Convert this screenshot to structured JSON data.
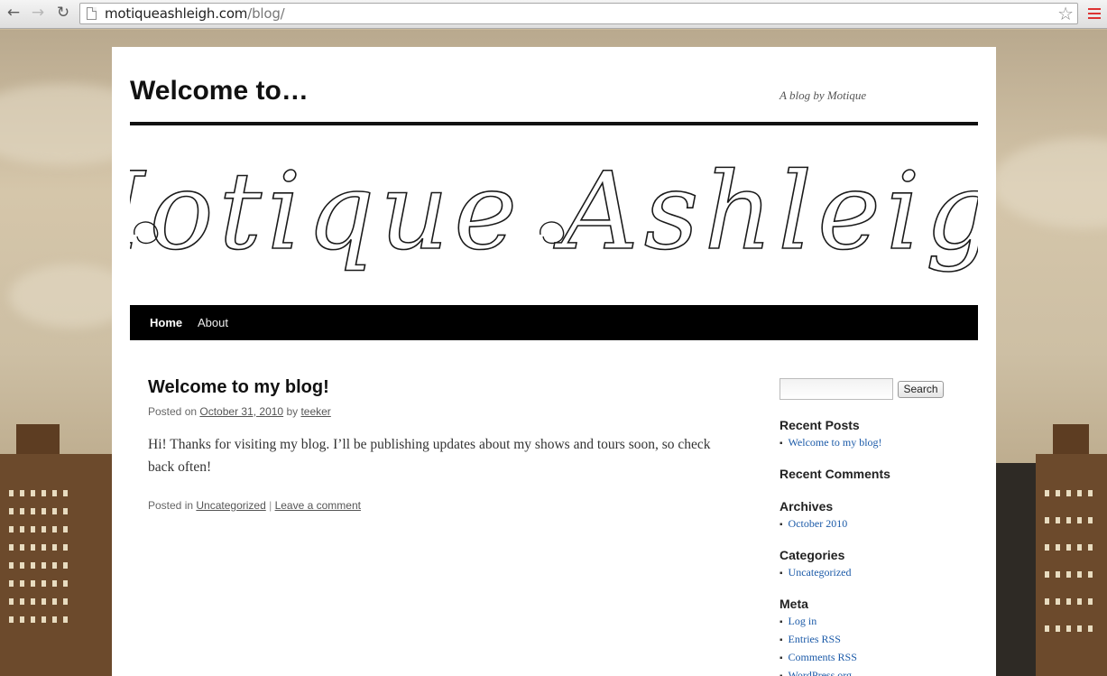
{
  "browser": {
    "url_host": "motiqueashleigh.com",
    "url_path": "/blog/",
    "back_icon": "back-arrow-icon",
    "forward_icon": "forward-arrow-icon",
    "reload_icon": "reload-icon",
    "bookmark_icon": "star-icon",
    "menu_icon": "menu-icon"
  },
  "site": {
    "title": "Welcome to…",
    "description": "A blog by Motique",
    "header_text": "Motique Ashleigh"
  },
  "nav": {
    "items": [
      {
        "label": "Home",
        "current": true
      },
      {
        "label": "About",
        "current": false
      }
    ]
  },
  "post": {
    "title": "Welcome to my blog!",
    "meta_prefix": "Posted on ",
    "date": "October 31, 2010",
    "by": " by ",
    "author": "teeker",
    "content": "Hi!  Thanks for visiting my blog.  I’ll be publishing updates about my shows and tours soon, so check back often!",
    "footer_prefix": "Posted in ",
    "category": "Uncategorized",
    "separator": " | ",
    "comment_link": "Leave a comment"
  },
  "sidebar": {
    "search_button": "Search",
    "recent_posts_title": "Recent Posts",
    "recent_posts": [
      "Welcome to my blog!"
    ],
    "recent_comments_title": "Recent Comments",
    "archives_title": "Archives",
    "archives": [
      "October 2010"
    ],
    "categories_title": "Categories",
    "categories": [
      "Uncategorized"
    ],
    "meta_title": "Meta",
    "meta": [
      "Log in",
      "Entries RSS",
      "Comments RSS",
      "WordPress.org"
    ]
  },
  "colors": {
    "link": "#1b5aa8",
    "menu_bg": "#000000"
  }
}
